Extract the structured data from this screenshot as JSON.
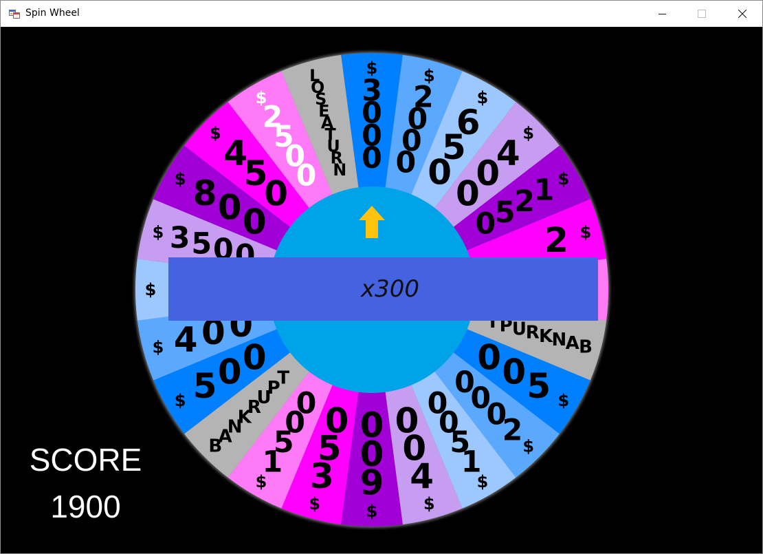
{
  "window": {
    "title": "Spin Wheel",
    "icon": "app-window-icon",
    "controls": [
      "minimize-icon",
      "maximize-icon",
      "close-icon"
    ]
  },
  "wheel": {
    "hub_color": "#00a2e8",
    "pointer_color": "#ffc20e",
    "segments": [
      {
        "label": "$3000",
        "color": "#0080ff",
        "text_color": "#000000"
      },
      {
        "label": "$2000",
        "color": "#5aa9ff",
        "text_color": "#000000"
      },
      {
        "label": "$650",
        "color": "#9cc8ff",
        "text_color": "#000000"
      },
      {
        "label": "$400",
        "color": "#c79df2",
        "text_color": "#000000"
      },
      {
        "label": "$1250",
        "color": "#a000d6",
        "text_color": "#000000"
      },
      {
        "label": "$2",
        "color": "#ff00ff",
        "text_color": "#000000"
      },
      {
        "label": "$",
        "color": "#ff7af7",
        "text_color": "#000000"
      },
      {
        "label": "BANKRUPT",
        "color": "#b4b4b4",
        "text_color": "#000000"
      },
      {
        "label": "$500",
        "color": "#0080ff",
        "text_color": "#000000"
      },
      {
        "label": "$2000",
        "color": "#5aa9ff",
        "text_color": "#000000"
      },
      {
        "label": "$1500",
        "color": "#9cc8ff",
        "text_color": "#000000"
      },
      {
        "label": "$400",
        "color": "#c79df2",
        "text_color": "#000000"
      },
      {
        "label": "$900",
        "color": "#a000d6",
        "text_color": "#000000"
      },
      {
        "label": "$350",
        "color": "#ff00ff",
        "text_color": "#000000"
      },
      {
        "label": "$1500",
        "color": "#ff7af7",
        "text_color": "#000000"
      },
      {
        "label": "BANKRUPT",
        "color": "#b4b4b4",
        "text_color": "#000000"
      },
      {
        "label": "$500",
        "color": "#0080ff",
        "text_color": "#000000"
      },
      {
        "label": "$400",
        "color": "#5aa9ff",
        "text_color": "#000000"
      },
      {
        "label": "$",
        "color": "#9cc8ff",
        "text_color": "#000000"
      },
      {
        "label": "$3500",
        "color": "#c79df2",
        "text_color": "#000000"
      },
      {
        "label": "$800",
        "color": "#a000d6",
        "text_color": "#000000"
      },
      {
        "label": "$450",
        "color": "#ff00ff",
        "text_color": "#000000"
      },
      {
        "label": "$2500",
        "color": "#ff7af7",
        "text_color": "#ffffff"
      },
      {
        "label": "LOSE A TURN",
        "color": "#b4b4b4",
        "text_color": "#000000"
      }
    ]
  },
  "banner": {
    "text": "x300"
  },
  "score": {
    "label": "SCORE",
    "value": "1900"
  }
}
